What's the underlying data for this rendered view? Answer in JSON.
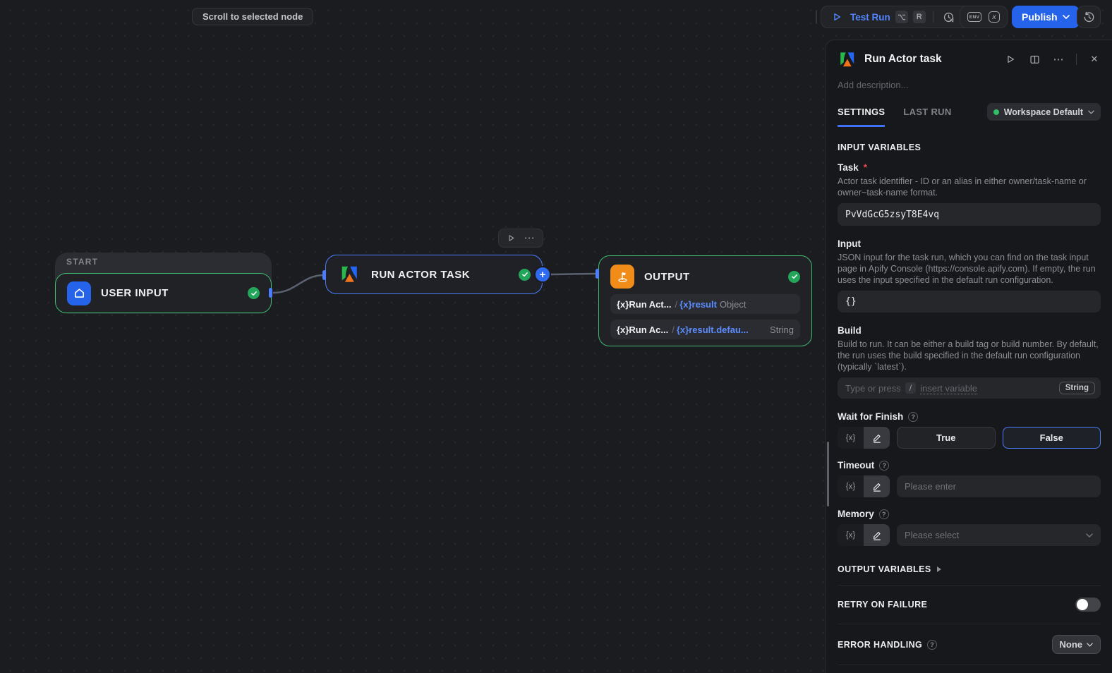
{
  "icons": {
    "plus": "+",
    "question": "?",
    "ellipsis": "⋯",
    "close": "✕"
  },
  "topbar": {
    "tooltip": "Scroll to selected node",
    "test_run_label": "Test Run",
    "shortcut_r": "R",
    "env_label": "ENV",
    "fx_label": "x",
    "publish_label": "Publish"
  },
  "canvas": {
    "start_label": "START",
    "user_input_title": "USER INPUT",
    "run_actor_title": "RUN ACTOR TASK",
    "output_title": "OUTPUT",
    "output_rows": [
      {
        "fx": "{x}",
        "name": "Run Act...",
        "slash": "/",
        "var_fx": "{x}",
        "var_name": "result",
        "type": "Object"
      },
      {
        "fx": "{x}",
        "name": "Run Ac...",
        "slash": "/",
        "var_fx": "{x}",
        "var_name": "result.defau...",
        "type": "String"
      }
    ]
  },
  "panel": {
    "title": "Run Actor task",
    "description_placeholder": "Add description...",
    "tab_settings": "SETTINGS",
    "tab_last_run": "LAST RUN",
    "workspace_label": "Workspace Default",
    "input_variables_heading": "INPUT VARIABLES",
    "task_label": "Task",
    "required_mark": "*",
    "task_description": "Actor task identifier - ID or an alias in either owner/task-name or owner~task-name format.",
    "task_value": "PvVdGcG5zsyT8E4vq",
    "input_label": "Input",
    "input_description": "JSON input for the task run, which you can find on the task input page in Apify Console (https://console.apify.com). If empty, the run uses the input specified in the default run configuration.",
    "input_value": "{}",
    "build_label": "Build",
    "build_description": "Build to run. It can be either a build tag or build number. By default, the run uses the build specified in the default run configuration (typically `latest`).",
    "build_placeholder_pre": "Type or press",
    "build_placeholder_key": "/",
    "build_placeholder_link": "insert variable",
    "build_type_badge": "String",
    "wait_label": "Wait for Finish",
    "fx_badge": "{x}",
    "true_label": "True",
    "false_label": "False",
    "timeout_label": "Timeout",
    "timeout_placeholder": "Please enter",
    "memory_label": "Memory",
    "memory_placeholder": "Please select",
    "output_variables_heading": "OUTPUT VARIABLES",
    "retry_heading": "RETRY ON FAILURE",
    "error_heading": "ERROR HANDLING",
    "error_value": "None"
  },
  "colors": {
    "accent_blue": "#2563eb",
    "selection_blue": "#4c7dff",
    "node_green": "#3fbb72",
    "check_green": "#23a55a",
    "panel_bg": "#17181b",
    "canvas_bg": "#1b1c1f"
  }
}
